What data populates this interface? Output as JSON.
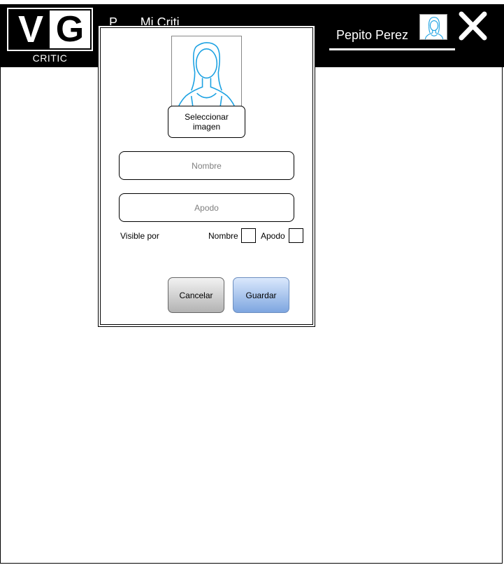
{
  "header": {
    "logo_letters_left": "V",
    "logo_letters_right": "G",
    "logo_subtitle": "CRITIC",
    "title_partial": "P...... Mi Criti...",
    "user_name": "Pepito Perez",
    "close_icon": "close-x-icon",
    "avatar_icon": "user-avatar-icon"
  },
  "dialog": {
    "photo_icon": "person-silhouette-icon",
    "select_image_label": "Seleccionar imagen",
    "name_placeholder": "Nombre",
    "nickname_placeholder": "Apodo",
    "visible_by_label": "Visible por",
    "visible_options": [
      "Nombre",
      "Apodo"
    ],
    "cancel_label": "Cancelar",
    "save_label": "Guardar"
  },
  "colors": {
    "header_bg": "#000000",
    "silhouette": "#1ba1e2",
    "save_btn_top": "#dae8fc",
    "save_btn_bottom": "#7ea6e0",
    "cancel_btn_top": "#f2f2f2",
    "cancel_btn_bottom": "#b3b3b3"
  }
}
